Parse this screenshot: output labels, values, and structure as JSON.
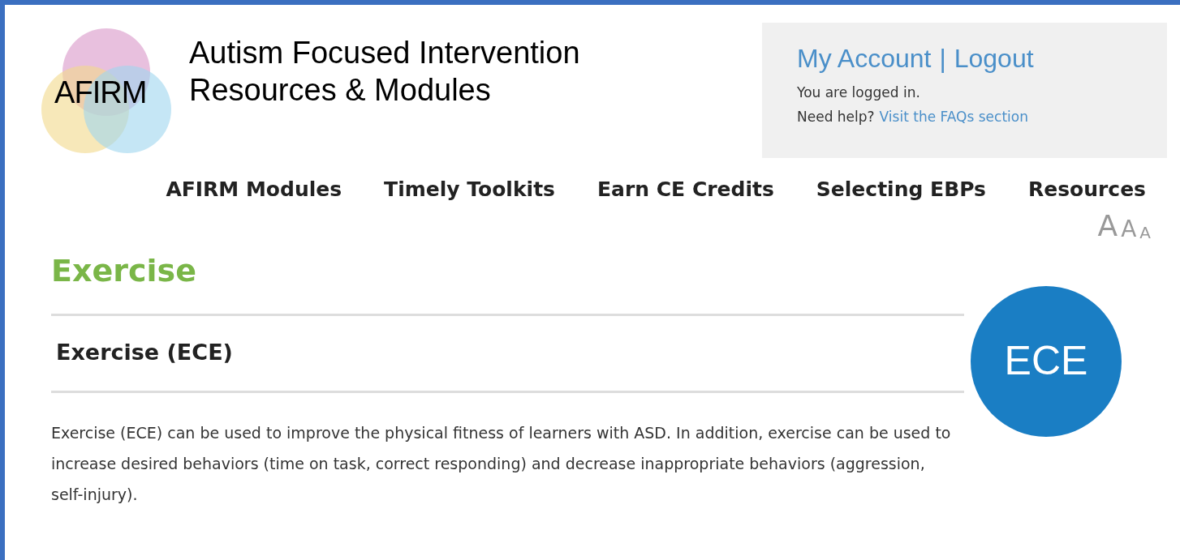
{
  "logo": {
    "text": "AFIRM"
  },
  "site_title": [
    "Autism Focused Intervention",
    "Resources & Modules"
  ],
  "account": {
    "links": [
      "My Account",
      "Logout"
    ],
    "separator": "|",
    "status": "You are logged in.",
    "help": "Need help?",
    "help_link": "Visit the FAQs section"
  },
  "nav": [
    "AFIRM Modules",
    "Timely Toolkits",
    "Earn CE Credits",
    "Selecting EBPs",
    "Resources"
  ],
  "font_sizes": [
    "A",
    "A",
    "A"
  ],
  "page_title": "Exercise",
  "section_heading": "Exercise (ECE)",
  "badge": "ECE",
  "description": "Exercise (ECE) can be used to improve the physical fitness of learners with ASD. In addition, exercise can be used to increase desired behaviors (time on task, correct responding) and decrease inappropriate behaviors (aggression, self-injury)."
}
